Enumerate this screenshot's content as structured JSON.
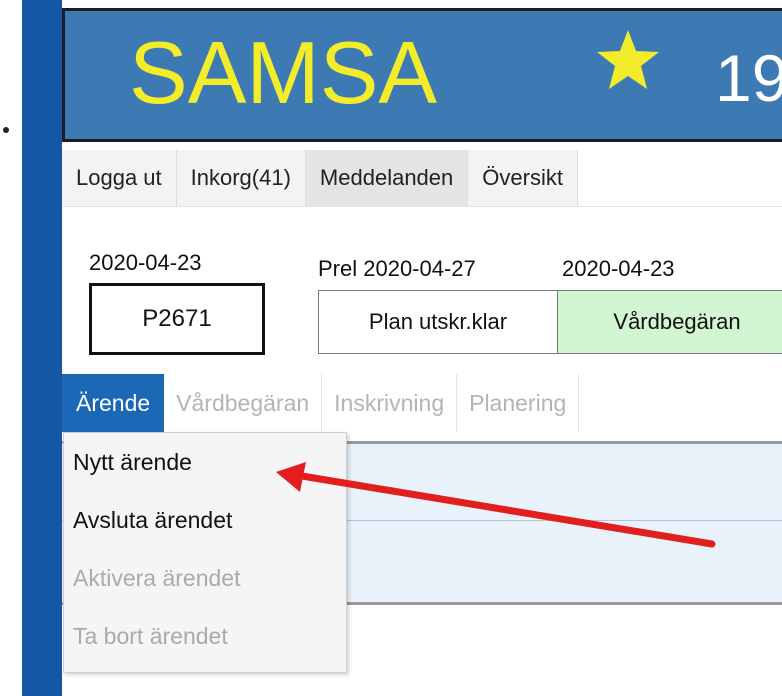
{
  "header": {
    "title": "SAMSA",
    "number": "19"
  },
  "nav": [
    "Logga ut",
    "Inkorg(41)",
    "Meddelanden",
    "Översikt"
  ],
  "case": {
    "date": "2020-04-23",
    "id": "P2671"
  },
  "status": {
    "date1": "Prel 2020-04-27",
    "date2": "2020-04-23",
    "cell1": "Plan utskr.klar",
    "cell2": "Vårdbegäran"
  },
  "tabs": [
    "Ärende",
    "Vårdbegäran",
    "Inskrivning",
    "Planering"
  ],
  "menu": {
    "items": [
      {
        "label": "Nytt ärende",
        "enabled": true
      },
      {
        "label": "Avsluta ärendet",
        "enabled": true
      },
      {
        "label": "Aktivera ärendet",
        "enabled": false
      },
      {
        "label": "Ta bort ärendet",
        "enabled": false
      }
    ]
  },
  "colors": {
    "header_bg": "#3d7ab3",
    "title": "#f2ec2a",
    "active_tab": "#1b69b6",
    "status_green": "#d2f5d2",
    "arrow": "#e31e1e"
  },
  "icons": {
    "star": "star-icon",
    "arrow": "arrow-annotation"
  }
}
